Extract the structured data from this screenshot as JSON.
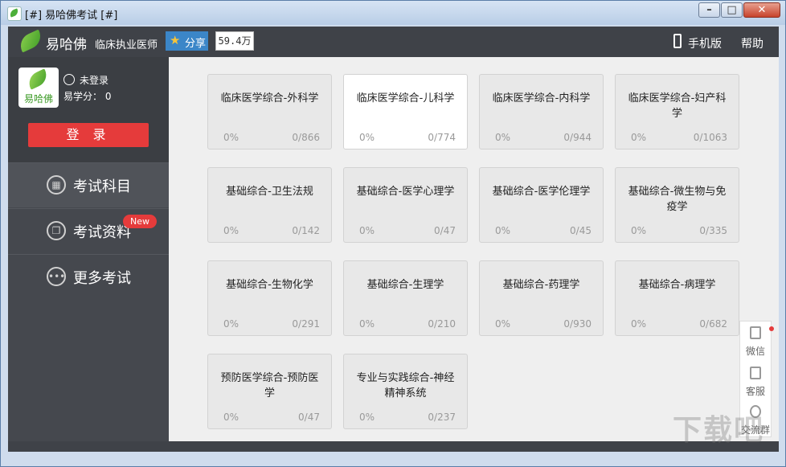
{
  "window": {
    "title": "[#] 易哈佛考试 [#]"
  },
  "window_controls": {
    "minimize": "–",
    "maximize": "□",
    "close": "✕"
  },
  "header": {
    "brand": "易哈佛",
    "subject": "临床执业医师",
    "share_label": "分享",
    "share_count": "59.4万",
    "mobile_label": "手机版",
    "help_label": "帮助"
  },
  "profile": {
    "avatar_text": "易哈佛",
    "login_status": "未登录",
    "points": "易学分： 0",
    "login_button": "登 录"
  },
  "nav": [
    {
      "label": "考试科目",
      "icon": "grid-icon"
    },
    {
      "label": "考试资料",
      "icon": "documents-icon",
      "badge": "New"
    },
    {
      "label": "更多考试",
      "icon": "more-icon"
    }
  ],
  "cards": [
    {
      "name": "临床医学综合-外科学",
      "progress": "0%",
      "count": "0/866"
    },
    {
      "name": "临床医学综合-儿科学",
      "progress": "0%",
      "count": "0/774"
    },
    {
      "name": "临床医学综合-内科学",
      "progress": "0%",
      "count": "0/944"
    },
    {
      "name": "临床医学综合-妇产科学",
      "progress": "0%",
      "count": "0/1063"
    },
    {
      "name": "基础综合-卫生法规",
      "progress": "0%",
      "count": "0/142"
    },
    {
      "name": "基础综合-医学心理学",
      "progress": "0%",
      "count": "0/47"
    },
    {
      "name": "基础综合-医学伦理学",
      "progress": "0%",
      "count": "0/45"
    },
    {
      "name": "基础综合-微生物与免疫学",
      "progress": "0%",
      "count": "0/335"
    },
    {
      "name": "基础综合-生物化学",
      "progress": "0%",
      "count": "0/291"
    },
    {
      "name": "基础综合-生理学",
      "progress": "0%",
      "count": "0/210"
    },
    {
      "name": "基础综合-药理学",
      "progress": "0%",
      "count": "0/930"
    },
    {
      "name": "基础综合-病理学",
      "progress": "0%",
      "count": "0/682"
    },
    {
      "name": "预防医学综合-预防医学",
      "progress": "0%",
      "count": "0/47"
    },
    {
      "name": "专业与实践综合-神经精神系统",
      "progress": "0%",
      "count": "0/237"
    }
  ],
  "float_panel": [
    {
      "label": "微信",
      "icon": "wechat-icon"
    },
    {
      "label": "客服",
      "icon": "chat-icon"
    },
    {
      "label": "交流群",
      "icon": "group-icon"
    }
  ],
  "watermark": "下载吧",
  "colors": {
    "accent_red": "#e53b3b",
    "header_dark": "#3f4248",
    "share_blue": "#3b86c8",
    "brand_green": "#3c9a26"
  }
}
